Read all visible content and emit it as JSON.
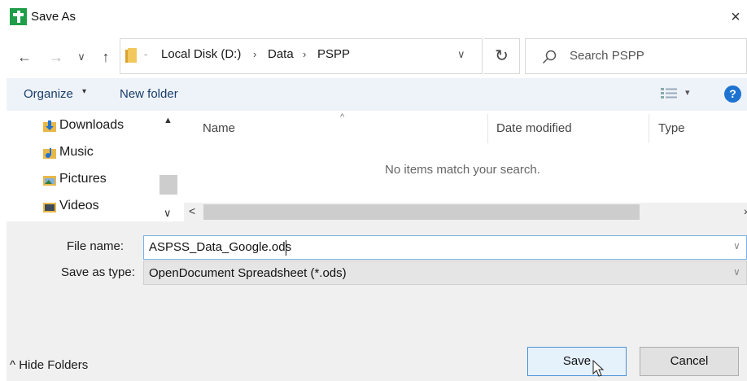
{
  "window": {
    "title": "Save As",
    "close_glyph": "×",
    "app_icon": "app-plus-icon"
  },
  "nav": {
    "back_glyph": "←",
    "forward_glyph": "→",
    "recent_glyph": "∨",
    "up_glyph": "↑"
  },
  "address": {
    "breadcrumbs": [
      "Local Disk (D:)",
      "Data",
      "PSPP"
    ],
    "separator": "›",
    "refresh_glyph": "↻"
  },
  "search": {
    "placeholder": "Search PSPP"
  },
  "toolbar": {
    "organize_label": "Organize",
    "organize_caret": "▾",
    "new_folder_label": "New folder",
    "view_caret": "▾",
    "help_label": "?"
  },
  "sidebar": {
    "items": [
      {
        "label": "Downloads",
        "icon": "downloads-folder-icon"
      },
      {
        "label": "Music",
        "icon": "music-folder-icon"
      },
      {
        "label": "Pictures",
        "icon": "pictures-folder-icon"
      },
      {
        "label": "Videos",
        "icon": "videos-folder-icon"
      }
    ]
  },
  "file_list": {
    "columns": [
      "Name",
      "Date modified",
      "Type"
    ],
    "empty_message": "No items match your search."
  },
  "form": {
    "file_name_label": "File name:",
    "file_name_value": "ASPSS_Data_Google.ods",
    "save_type_label": "Save as type:",
    "save_type_value": "OpenDocument Spreadsheet (*.ods)"
  },
  "footer": {
    "hide_folders_label": "Hide Folders",
    "save_label": "Save",
    "cancel_label": "Cancel"
  },
  "colors": {
    "accent": "#1e73d1",
    "toolbar_bg": "#eef3f9",
    "panel_bg": "#f0f0f0",
    "app_icon": "#1f9e4a",
    "folder": "#e8b84a"
  }
}
